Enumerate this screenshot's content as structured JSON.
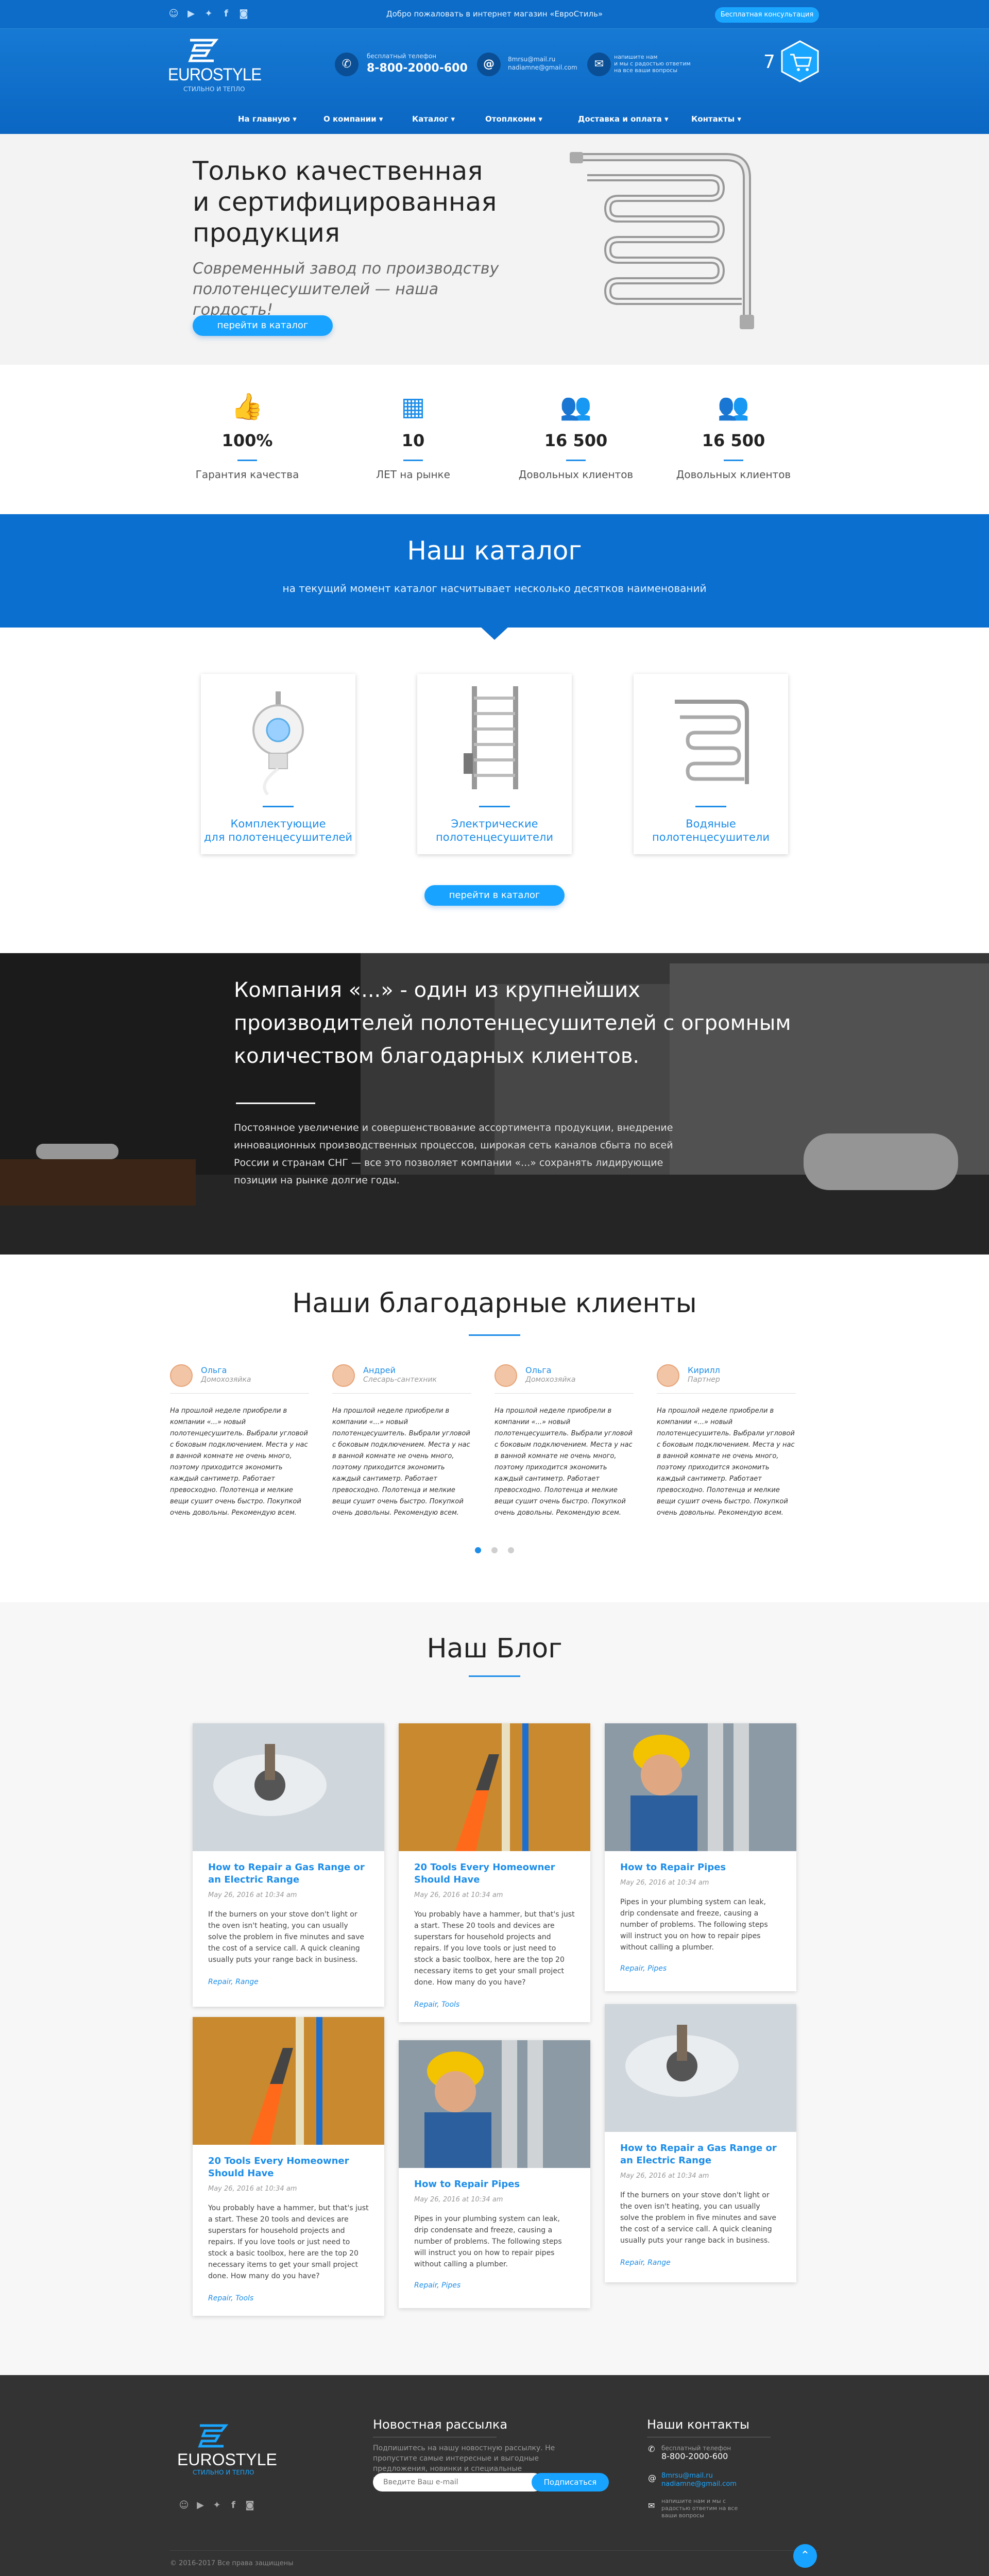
{
  "topbar": {
    "welcome": "Добро пожаловать в интернет магазин «ЕвроСтиль»",
    "consult_label": "Бесплатная консультация"
  },
  "logo": {
    "name": "EUROSTYLE",
    "tagline": "СТИЛЬНО И ТЕПЛО"
  },
  "contacts": {
    "phone_caption": "бесплатный телефон",
    "phone": "8-800-2000-600",
    "email1": "8mrsu@mail.ru",
    "email2": "nadiamne@gmail.com",
    "write_line1": "напишите нам",
    "write_line2": "и мы с радостью ответим",
    "write_line3": "на все ваши вопросы"
  },
  "cart": {
    "count": "7"
  },
  "nav": {
    "items": [
      "На главную",
      "О компании",
      "Каталог",
      "Отоплкомм",
      "Доставка и оплата",
      "Контакты"
    ]
  },
  "hero": {
    "title_line1": "Только качественная",
    "title_line2": "и сертифицированная",
    "title_line3": "продукция",
    "subtitle": "Современный завод по производству полотенцесушителей — наша гордость!",
    "button": "перейти в каталог"
  },
  "stats": [
    {
      "value": "100%",
      "label": "Гарантия качества",
      "icon": "thumbs-up-icon"
    },
    {
      "value": "10",
      "label": "ЛЕТ на рынке",
      "icon": "calendar-icon"
    },
    {
      "value": "16 500",
      "label": "Довольных клиентов",
      "icon": "users-icon"
    },
    {
      "value": "16 500",
      "label": "Довольных клиентов",
      "icon": "users-icon"
    }
  ],
  "catalog": {
    "title": "Наш каталог",
    "subtitle": "на текущий момент каталог насчитывает несколько десятков наименований",
    "button": "перейти в каталог",
    "cards": [
      {
        "line1": "Комплектующие",
        "line2": "для полотенцесушителей"
      },
      {
        "line1": "Электрические",
        "line2": "полотенцесушители"
      },
      {
        "line1": "Водяные",
        "line2": "полотенцесушители"
      }
    ]
  },
  "banner": {
    "title": "Компания «...» - один из крупнейших производителей полотенцесушителей с огромным количеством благодарных клиентов.",
    "text": "Постоянное увеличение и совершенствование ассортимента продукции, внедрение инновационных производственных процессов, широкая сеть каналов сбыта по всей России и странам СНГ — все это позволяет компании «...» сохранять лидирующие позиции на рынке долгие годы."
  },
  "reviews": {
    "title": "Наши благодарные клиенты",
    "items": [
      {
        "name": "Ольга",
        "role": "Домохозяйка",
        "text": "На прошлой неделе приобрели в компании «...» новый полотенцесушитель. Выбрали угловой с боковым подключением. Места у нас в ванной комнате не очень много, поэтому приходится экономить каждый сантиметр. Работает превосходно. Полотенца и мелкие вещи сушит очень быстро. Покупкой очень довольны. Рекомендую всем."
      },
      {
        "name": "Андрей",
        "role": "Слесарь-сантехник",
        "text": "На прошлой неделе приобрели в компании «...» новый полотенцесушитель. Выбрали угловой с боковым подключением. Места у нас в ванной комнате не очень много, поэтому приходится экономить каждый сантиметр. Работает превосходно. Полотенца и мелкие вещи сушит очень быстро. Покупкой очень довольны. Рекомендую всем."
      },
      {
        "name": "Ольга",
        "role": "Домохозяйка",
        "text": "На прошлой неделе приобрели в компании «...» новый полотенцесушитель. Выбрали угловой с боковым подключением. Места у нас в ванной комнате не очень много, поэтому приходится экономить каждый сантиметр. Работает превосходно. Полотенца и мелкие вещи сушит очень быстро. Покупкой очень довольны. Рекомендую всем."
      },
      {
        "name": "Кирилл",
        "role": "Партнер",
        "text": "На прошлой неделе приобрели в компании «...» новый полотенцесушитель. Выбрали угловой с боковым подключением. Места у нас в ванной комнате не очень много, поэтому приходится экономить каждый сантиметр. Работает превосходно. Полотенца и мелкие вещи сушит очень быстро. Покупкой очень довольны. Рекомендую всем."
      }
    ]
  },
  "blog": {
    "title": "Наш Блог",
    "posts": [
      {
        "title": "How to Repair a Gas Range or an Electric Range",
        "date": "May 26, 2016 at 10:34 am",
        "body": "If the burners on your stove don't light or the oven isn't heating, you can usually solve the problem in five minutes and save the cost of a service call. A quick cleaning usually puts your range back in business.",
        "tags": "Repair, Range"
      },
      {
        "title": "20 Tools Every Homeowner Should Have",
        "date": "May 26, 2016 at 10:34 am",
        "body": "You probably have a hammer, but that's just a start. These 20 tools and devices are superstars for household projects and repairs. If you love tools or just need to stock a basic toolbox, here are the top 20 necessary items to get your small project done. How many do you have?",
        "tags": "Repair, Tools"
      },
      {
        "title": "How to Repair Pipes",
        "date": "May 26, 2016 at 10:34 am",
        "body": "Pipes in your plumbing system can leak, drip condensate and freeze, causing a number of problems. The following steps will instruct you on how to repair pipes without calling a plumber.",
        "tags": "Repair, Pipes"
      },
      {
        "title": "20 Tools Every Homeowner Should Have",
        "date": "May 26, 2016 at 10:34 am",
        "body": "You probably have a hammer, but that's just a start. These 20 tools and devices are superstars for household projects and repairs. If you love tools or just need to stock a basic toolbox, here are the top 20 necessary items to get your small project done. How many do you have?",
        "tags": "Repair, Tools"
      },
      {
        "title": "How to Repair Pipes",
        "date": "May 26, 2016 at 10:34 am",
        "body": "Pipes in your plumbing system can leak, drip condensate and freeze, causing a number of problems. The following steps will instruct you on how to repair pipes without calling a plumber.",
        "tags": "Repair, Pipes"
      },
      {
        "title": "How to Repair a Gas Range or an Electric Range",
        "date": "May 26, 2016 at 10:34 am",
        "body": "If the burners on your stove don't light or the oven isn't heating, you can usually solve the problem in five minutes and save the cost of a service call. A quick cleaning usually puts your range back in business.",
        "tags": "Repair, Range"
      }
    ]
  },
  "footer": {
    "newsletter_title": "Новостная рассылка",
    "newsletter_text": "Подпишитесь на нашу новостную рассылку. Не пропустите самые интересные и выгодные предложения, новинки и специальные предложения.",
    "email_placeholder": "Введите Ваш e-mail",
    "subscribe": "Подписаться",
    "contacts_title": "Наши контакты",
    "phone_caption": "бесплатный телефон",
    "phone": "8-800-2000-600",
    "email1": "8mrsu@mail.ru",
    "email2": "nadiamne@gmail.com",
    "write": "напишите нам и мы с радостью ответим на все ваши вопросы",
    "copyright": "© 2016-2017 Все права защищены"
  },
  "colors": {
    "primary": "#0b6fd0",
    "accent": "#17a3ff",
    "footer": "#333333"
  }
}
